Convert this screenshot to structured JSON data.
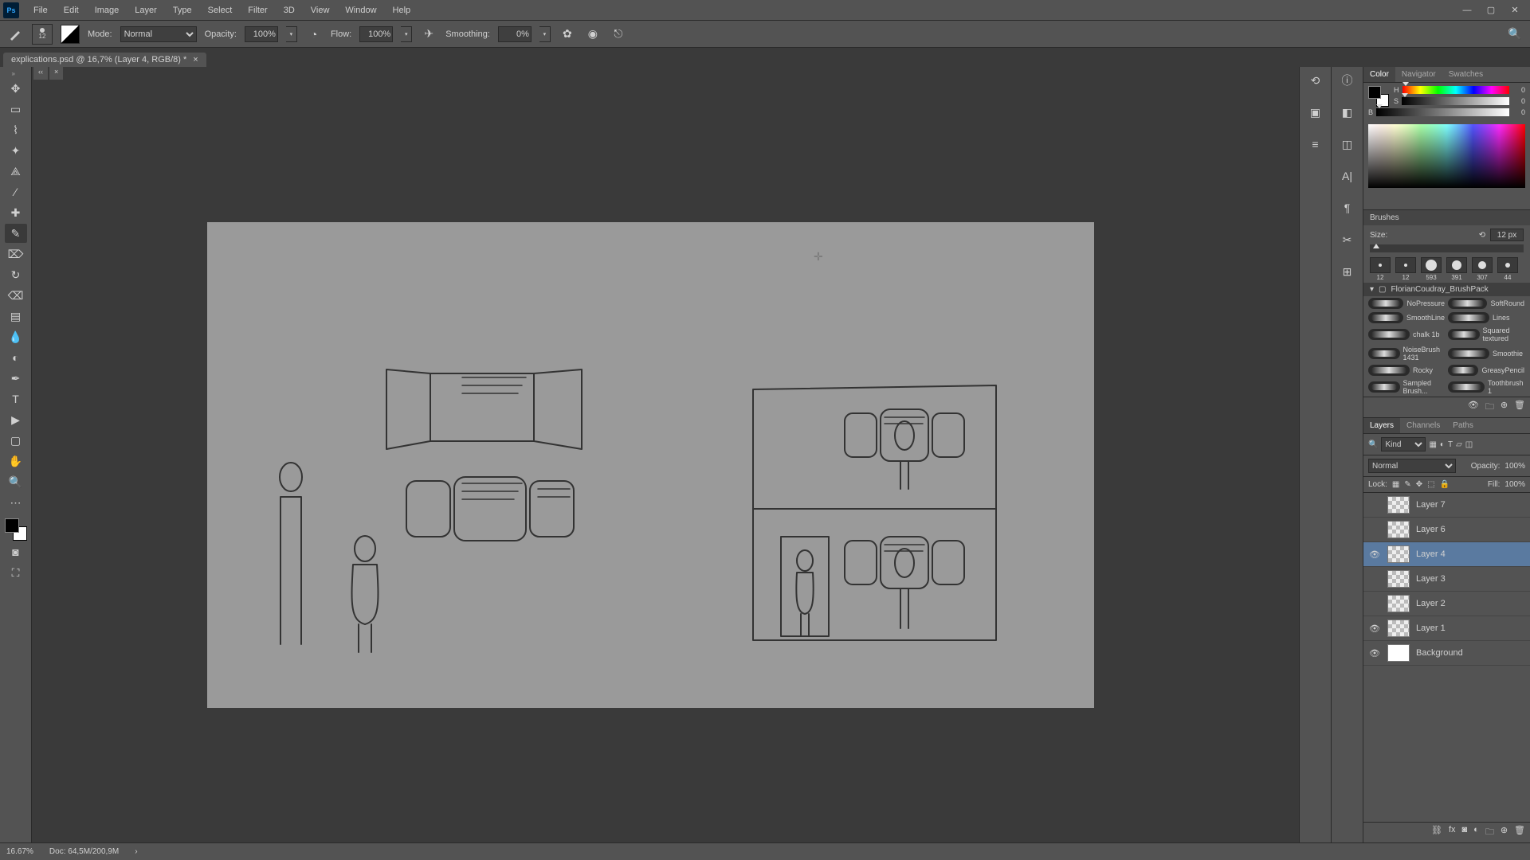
{
  "menubar": {
    "logo": "Ps",
    "items": [
      "File",
      "Edit",
      "Image",
      "Layer",
      "Type",
      "Select",
      "Filter",
      "3D",
      "View",
      "Window",
      "Help"
    ]
  },
  "options": {
    "brush_size_label": "12",
    "mode_label": "Mode:",
    "mode_value": "Normal",
    "opacity_label": "Opacity:",
    "opacity_value": "100%",
    "flow_label": "Flow:",
    "flow_value": "100%",
    "smoothing_label": "Smoothing:",
    "smoothing_value": "0%"
  },
  "doc": {
    "title": "explications.psd @ 16,7% (Layer 4, RGB/8) *"
  },
  "status": {
    "zoom": "16.67%",
    "doc": "Doc: 64,5M/200,9M",
    "arrow": "›"
  },
  "color_panel": {
    "tabs": [
      "Color",
      "Navigator",
      "Swatches"
    ],
    "sliders": [
      {
        "label": "H",
        "value": "0"
      },
      {
        "label": "S",
        "value": "0"
      },
      {
        "label": "B",
        "value": "0"
      }
    ]
  },
  "brushes": {
    "title": "Brushes",
    "size_label": "Size:",
    "size_value": "12 px",
    "thumbs": [
      {
        "label": "12",
        "d": 4
      },
      {
        "label": "12",
        "d": 4
      },
      {
        "label": "593",
        "d": 14
      },
      {
        "label": "391",
        "d": 12
      },
      {
        "label": "307",
        "d": 10
      },
      {
        "label": "44",
        "d": 6
      }
    ],
    "folder": "FlorianCoudray_BrushPack",
    "list": [
      [
        "NoPressure",
        "SoftRound"
      ],
      [
        "SmoothLine",
        "Lines"
      ],
      [
        "chalk 1b",
        "Squared textured"
      ],
      [
        "NoiseBrush 1431",
        "Smoothie"
      ],
      [
        "Rocky",
        "GreasyPencil"
      ],
      [
        "Sampled Brush...",
        "Toothbrush 1"
      ]
    ]
  },
  "layers": {
    "tabs": [
      "Layers",
      "Channels",
      "Paths"
    ],
    "kind_label": "Kind",
    "blend_mode": "Normal",
    "opacity_label": "Opacity:",
    "opacity_value": "100%",
    "lock_label": "Lock:",
    "fill_label": "Fill:",
    "fill_value": "100%",
    "items": [
      {
        "name": "Layer 7",
        "visible": false,
        "selected": false,
        "bg": false
      },
      {
        "name": "Layer 6",
        "visible": false,
        "selected": false,
        "bg": false
      },
      {
        "name": "Layer 4",
        "visible": true,
        "selected": true,
        "bg": false
      },
      {
        "name": "Layer 3",
        "visible": false,
        "selected": false,
        "bg": false
      },
      {
        "name": "Layer 2",
        "visible": false,
        "selected": false,
        "bg": false
      },
      {
        "name": "Layer 1",
        "visible": true,
        "selected": false,
        "bg": false
      },
      {
        "name": "Background",
        "visible": true,
        "selected": false,
        "bg": true
      }
    ]
  }
}
